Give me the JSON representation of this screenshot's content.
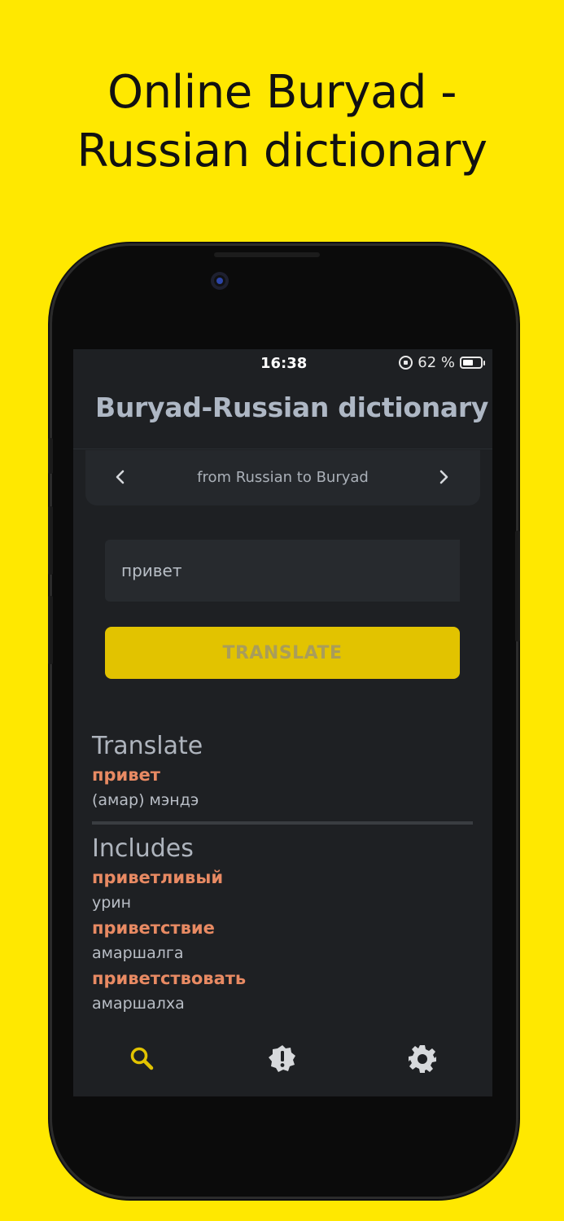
{
  "headline": {
    "line1": "Online Buryad -",
    "line2": "Russian dictionary"
  },
  "status_bar": {
    "time": "16:38",
    "battery_text": "62 %",
    "battery_level": 0.62
  },
  "app": {
    "title": "Buryad-Russian dictionary",
    "direction": {
      "prev_icon": "chevron-left-icon",
      "label": "from Russian to Buryad",
      "next_icon": "chevron-right-icon"
    },
    "search": {
      "value": "привет",
      "placeholder": ""
    },
    "translate_button": "TRANSLATE",
    "translate_section": {
      "heading": "Translate",
      "entries": [
        {
          "word": "привет",
          "translation": "(амар) мэндэ"
        }
      ]
    },
    "includes_section": {
      "heading": "Includes",
      "entries": [
        {
          "word": "приветливый",
          "translation": "урин"
        },
        {
          "word": "приветствие",
          "translation": "амаршалга"
        },
        {
          "word": "приветствовать",
          "translation": "амаршалха"
        }
      ]
    },
    "bottom_nav": [
      {
        "icon": "search-icon",
        "active": true
      },
      {
        "icon": "alert-badge-icon",
        "active": false
      },
      {
        "icon": "gear-icon",
        "active": false
      }
    ]
  },
  "colors": {
    "background": "#FFE800",
    "screen_bg": "#1E2023",
    "accent": "#E2C300",
    "word_color": "#E88A63"
  }
}
